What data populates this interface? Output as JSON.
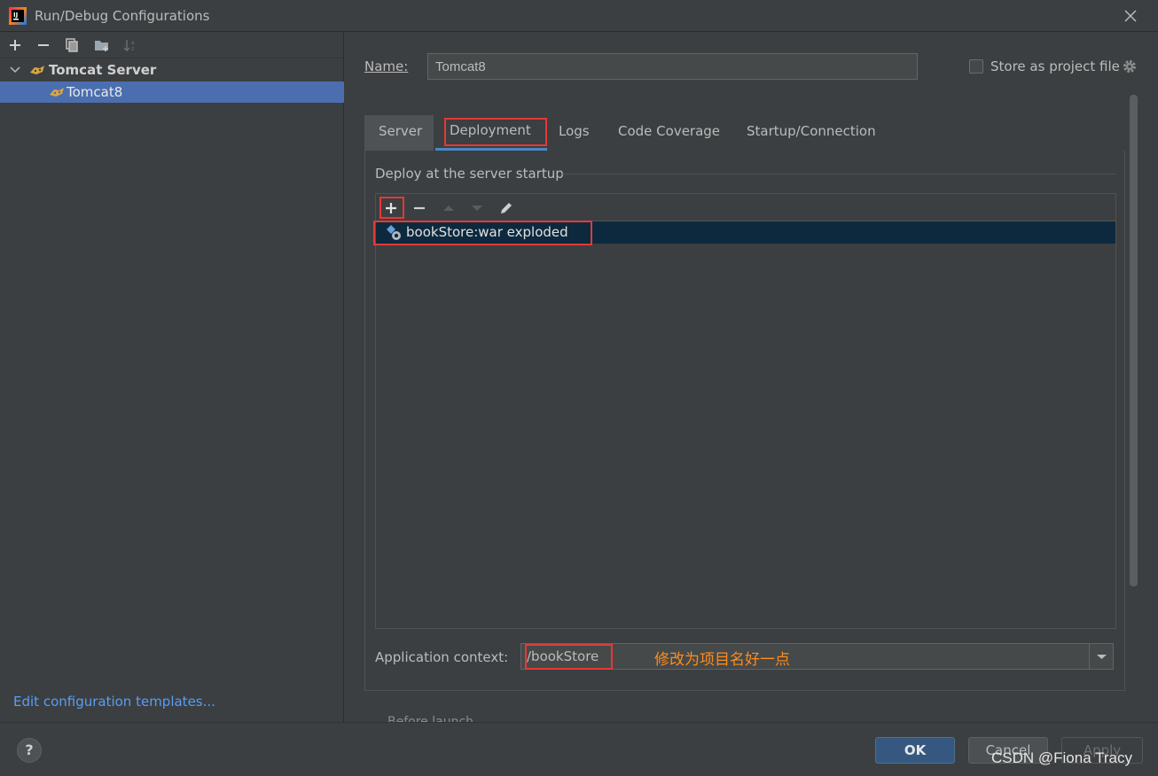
{
  "window": {
    "title": "Run/Debug Configurations"
  },
  "left": {
    "toolbar_icons": [
      "add-icon",
      "remove-icon",
      "copy-icon",
      "folder-add-icon",
      "sort-icon"
    ],
    "tree": {
      "group": "Tomcat Server",
      "item": "Tomcat8"
    },
    "edit_templates": "Edit configuration templates..."
  },
  "config": {
    "name_label": "Name:",
    "name_value": "Tomcat8",
    "store_label": "Store as project file"
  },
  "tabs": [
    "Server",
    "Deployment",
    "Logs",
    "Code Coverage",
    "Startup/Connection"
  ],
  "active_tab": "Deployment",
  "deployment": {
    "group_title": "Deploy at the server startup",
    "artifacts": [
      "bookStore:war exploded"
    ],
    "context_label": "Application context:",
    "context_value": "/bookStore",
    "annotation": "修改为项目名好一点"
  },
  "cutoff_text": "Before launch",
  "buttons": {
    "help": "?",
    "ok": "OK",
    "cancel": "Cancel",
    "apply": "Apply"
  },
  "watermark": "CSDN @Fiona Tracy",
  "colors": {
    "accent": "#4b6eaf",
    "highlight_box": "#e53935",
    "annotation": "#ff8c1a",
    "link": "#589df6"
  }
}
